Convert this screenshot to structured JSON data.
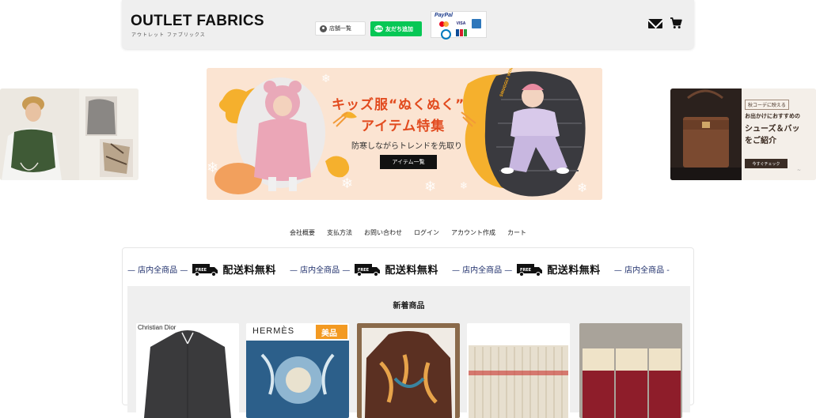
{
  "header": {
    "logo": "OUTLET FABRICS",
    "logo_sub": "アウトレット ファブリックス",
    "store_button": "店舗一覧",
    "line_button": "友だち追加",
    "line_bubble": "LINE",
    "paypal_label": "PayPal",
    "visa_label": "VISA"
  },
  "carousel": {
    "main": {
      "title_line1": "キッズ服“ぬくぬく”",
      "title_line2": "アイテム特集",
      "subtitle": "防寒しながらトレンドを先取り",
      "button": "アイテム一覧",
      "tag": "SNUGGLY WINTER"
    },
    "right": {
      "badge": "秋コーデに映える",
      "line1": "お出かけにおすすめの",
      "line2": "シューズ＆バッ",
      "line3": "をご紹介",
      "button": "今すぐチェック"
    }
  },
  "nav": {
    "items": [
      "会社概要",
      "支払方法",
      "お問い合わせ",
      "ログイン",
      "アカウント作成",
      "カート"
    ]
  },
  "ticker": {
    "store_text": "— 店内全商品 —",
    "free_text": "配送料無料",
    "truck_label": "FREE",
    "tail_text": "— 店内全商品 -"
  },
  "new_items": {
    "title": "新着商品",
    "products": [
      {
        "label": "Christian Dior"
      },
      {
        "label": "HERMÈS",
        "badge": "美品"
      },
      {
        "label": ""
      },
      {
        "label": ""
      },
      {
        "label": ""
      }
    ]
  },
  "colors": {
    "line_green": "#06c755",
    "banner_orange": "#e24b1f",
    "ticker_navy": "#1f2f6b"
  },
  "icons": [
    "store-icon",
    "line-icon",
    "mail-icon",
    "cart-icon",
    "truck-icon"
  ]
}
